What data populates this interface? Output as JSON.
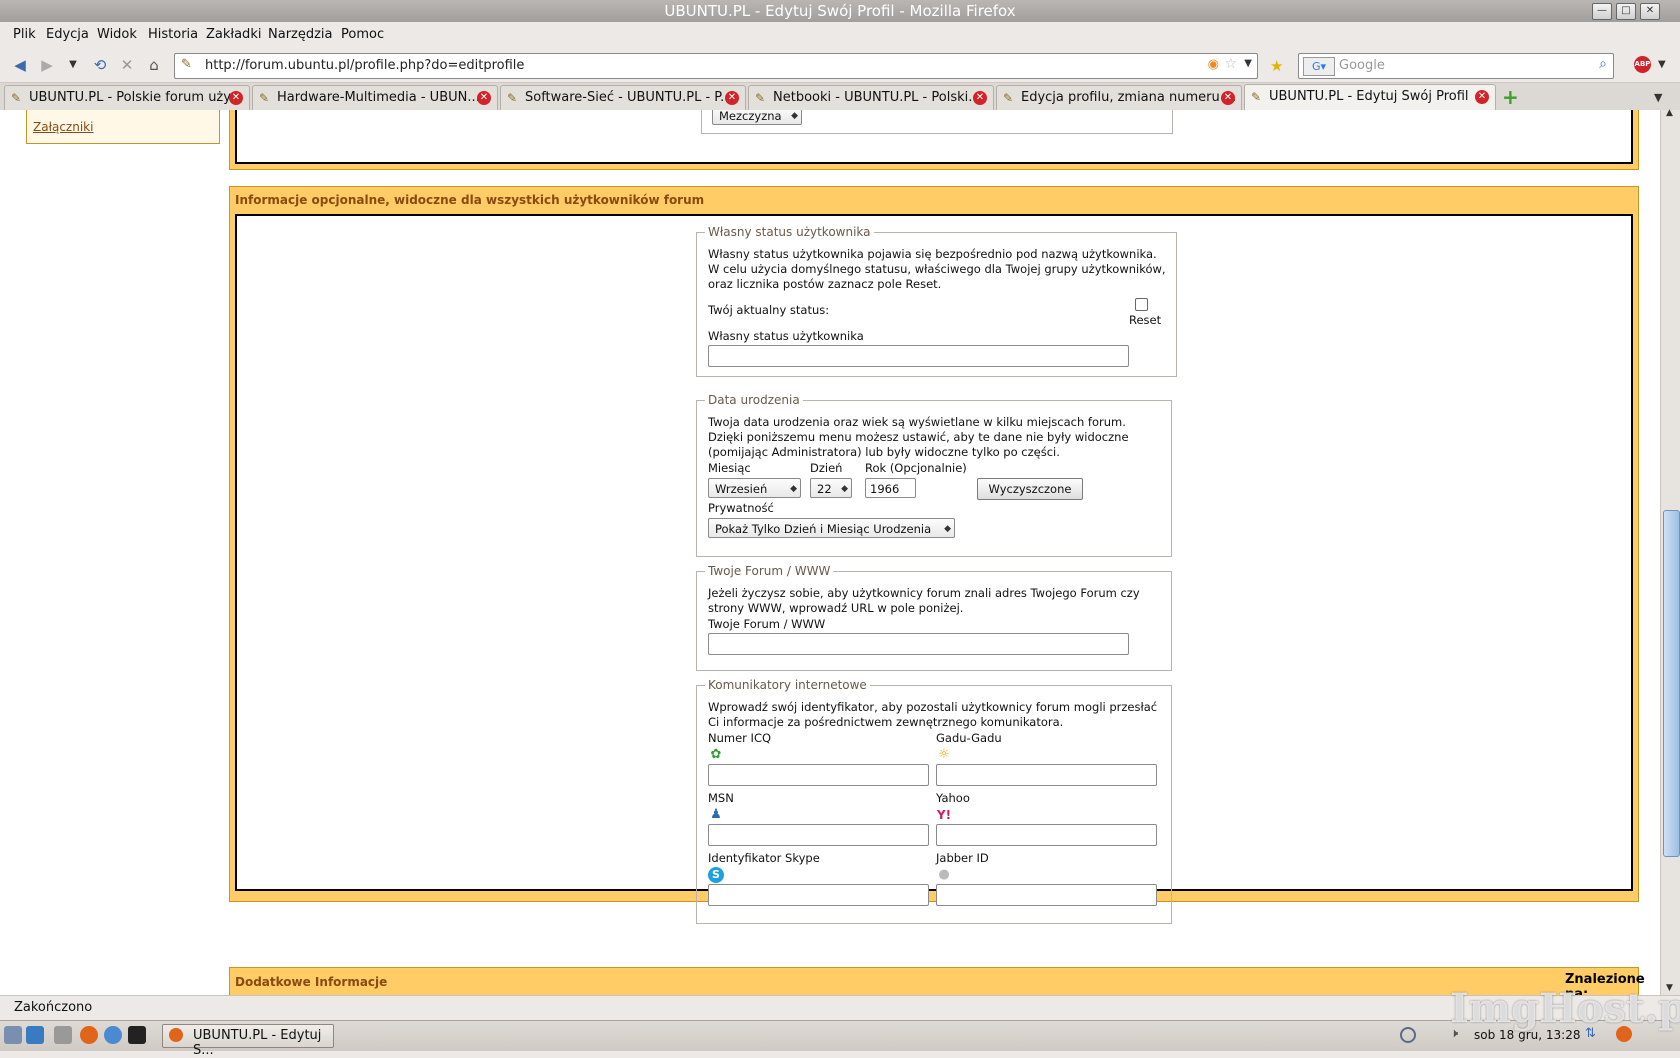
{
  "window": {
    "title": "UBUNTU.PL - Edytuj Swój Profil - Mozilla Firefox"
  },
  "menubar": {
    "items": [
      "Plik",
      "Edycja",
      "Widok",
      "Historia",
      "Zakładki",
      "Narzędzia",
      "Pomoc"
    ]
  },
  "navbar": {
    "url": "http://forum.ubuntu.pl/profile.php?do=editprofile",
    "search_placeholder": "Google"
  },
  "tabs": [
    {
      "label": "UBUNTU.PL - Polskie forum uży...",
      "active": false
    },
    {
      "label": "Hardware-Multimedia - UBUN...",
      "active": false
    },
    {
      "label": "Software-Sieć - UBUNTU.PL - P...",
      "active": false
    },
    {
      "label": "Netbooki - UBUNTU.PL - Polski...",
      "active": false
    },
    {
      "label": "Edycja profilu, zmiana numeru ...",
      "active": false
    },
    {
      "label": "UBUNTU.PL - Edytuj Swój Profil",
      "active": true
    }
  ],
  "sidebar": {
    "attachments_link": "Załączniki"
  },
  "gender": {
    "value": "Mezczyzna"
  },
  "optional_section": {
    "title": "Informacje opcjonalne, widoczne dla wszystkich użytkowników forum",
    "custom_status": {
      "legend": "Własny status użytkownika",
      "description_lines": [
        "Własny status użytkownika pojawia się bezpośrednio pod nazwą użytkownika.",
        "W celu użycia domyślnego statusu, właściwego dla Twojej grupy użytkowników,",
        "oraz licznika postów zaznacz pole Reset."
      ],
      "current_status_label": "Twój aktualny status:",
      "reset_label": "Reset",
      "field_label": "Własny status użytkownika",
      "field_value": ""
    },
    "birthday": {
      "legend": "Data urodzenia",
      "description_lines": [
        "Twoja data urodzenia oraz wiek są wyświetlane w kilku miejscach forum.",
        "Dzięki poniższemu menu możesz ustawić, aby te dane nie były widoczne",
        "(pomijając Administratora) lub były widoczne tylko po części."
      ],
      "month_label": "Miesiąc",
      "month_value": "Wrzesień",
      "day_label": "Dzień",
      "day_value": "22",
      "year_label": "Rok (Opcjonalnie)",
      "year_value": "1966",
      "clear_button": "Wyczyszczone",
      "privacy_label": "Prywatność",
      "privacy_value": "Pokaż Tylko Dzień i Miesiąc Urodzenia"
    },
    "website": {
      "legend": "Twoje Forum / WWW",
      "description_lines": [
        "Jeżeli życzysz sobie, aby użytkownicy forum znali adres Twojego Forum czy",
        "strony WWW, wprowadź URL w pole poniżej."
      ],
      "field_label": "Twoje Forum / WWW",
      "field_value": ""
    },
    "messengers": {
      "legend": "Komunikatory internetowe",
      "description_lines": [
        "Wprowadź swój identyfikator, aby pozostali użytkownicy forum mogli przesłać",
        "Ci informacje za pośrednictwem zewnętrznego komunikatora."
      ],
      "icq_label": "Numer ICQ",
      "gadu_label": "Gadu-Gadu",
      "msn_label": "MSN",
      "yahoo_label": "Yahoo",
      "skype_label": "Identyfikator Skype",
      "jabber_label": "Jabber ID"
    }
  },
  "extra_section": {
    "title": "Dodatkowe Informacje"
  },
  "find_bar": {
    "label": "Znalezione na:"
  },
  "statusbar": {
    "text": "Zakończono"
  },
  "taskbar": {
    "window_button": "UBUNTU.PL - Edytuj S...",
    "clock": "sob 18 gru, 13:28"
  },
  "watermark": "ImgHost.pl"
}
